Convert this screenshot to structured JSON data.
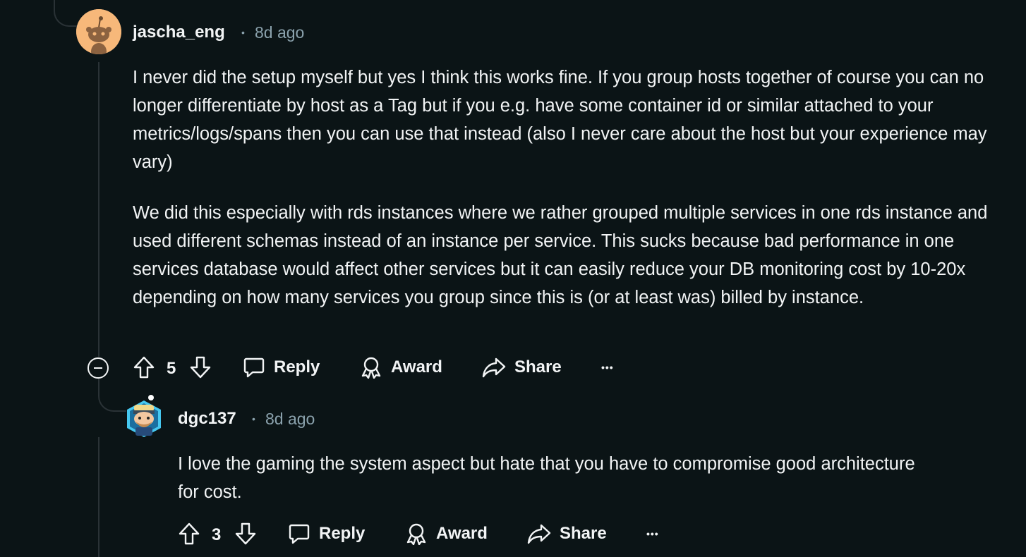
{
  "comments": [
    {
      "username": "jascha_eng",
      "separator": "•",
      "timestamp": "8d ago",
      "paragraphs": [
        "I never did the setup myself but yes I think this works fine. If you group hosts together of course you can no longer differentiate by host as a Tag but if you e.g. have some container id or similar attached to your metrics/logs/spans then you can use that instead (also I never care about the host but your experience may vary)",
        "We did this especially with rds instances where we rather grouped multiple services in one rds instance and used different schemas instead of an instance per service. This sucks because bad performance in one services database would affect other services but it can easily reduce your DB monitoring cost by 10-20x depending on how many services you group since this is (or at least was) billed by instance."
      ],
      "votes": "5",
      "actions": {
        "reply": "Reply",
        "award": "Award",
        "share": "Share",
        "more": "•••"
      }
    },
    {
      "username": "dgc137",
      "separator": "•",
      "timestamp": "8d ago",
      "paragraphs": [
        "I love the gaming the system aspect but hate that you have to compromise good architecture for cost."
      ],
      "votes": "3",
      "actions": {
        "reply": "Reply",
        "award": "Award",
        "share": "Share",
        "more": "•••"
      }
    }
  ],
  "icons": {
    "upvote": "arrow-up-icon",
    "downvote": "arrow-down-icon",
    "reply": "speech-bubble-icon",
    "award": "award-ribbon-icon",
    "share": "share-arrow-icon",
    "more": "ellipsis-icon",
    "collapse": "minus-circle-icon"
  },
  "colors": {
    "background": "#0b1416",
    "text": "#f2f4f5",
    "muted": "#8ba2ad",
    "thread_line": "#2a3236",
    "avatar1_bg": "#f7b87a",
    "avatar2_bg": "#46c8f0"
  }
}
